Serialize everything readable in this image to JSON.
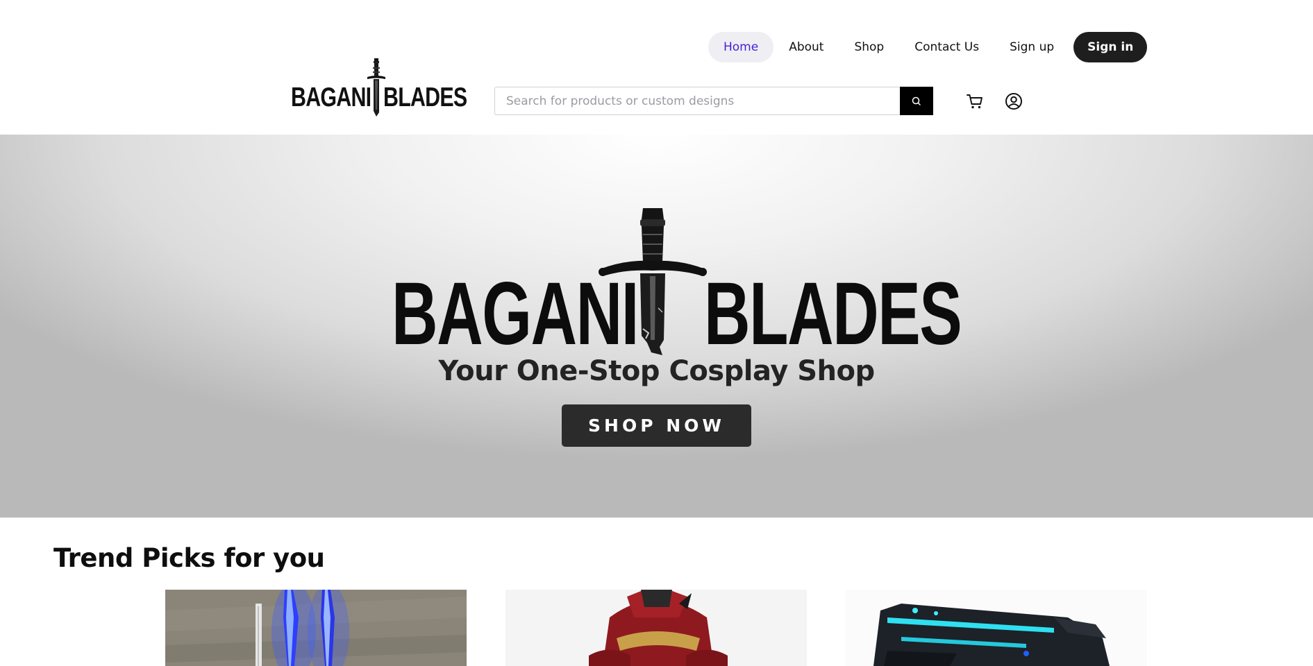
{
  "nav": {
    "items": [
      {
        "label": "Home",
        "active": true
      },
      {
        "label": "About"
      },
      {
        "label": "Shop"
      },
      {
        "label": "Contact Us"
      },
      {
        "label": "Sign up"
      }
    ],
    "signin_label": "Sign in"
  },
  "logo": {
    "left_word": "BAGANI",
    "right_word": "BLADES"
  },
  "search": {
    "placeholder": "Search for products or custom designs",
    "value": ""
  },
  "icons": {
    "search": "search-icon",
    "cart": "cart-icon",
    "account": "user-circle-icon"
  },
  "hero": {
    "logo_left": "BAGANI",
    "logo_right": "BLADES",
    "tagline": "Your One-Stop Cosplay Shop",
    "cta_label": "SHOP NOW"
  },
  "trend": {
    "title": "Trend Picks for you",
    "products": [
      {
        "image": "glowing-blue-sword-image"
      },
      {
        "image": "red-armor-helmet-image"
      },
      {
        "image": "cyan-neon-blaster-image"
      }
    ]
  },
  "colors": {
    "accent": "#4a1fd6",
    "dark": "#1e1e1e",
    "active_bg": "#eeeef3",
    "cta_bg": "#2b2b2b"
  }
}
